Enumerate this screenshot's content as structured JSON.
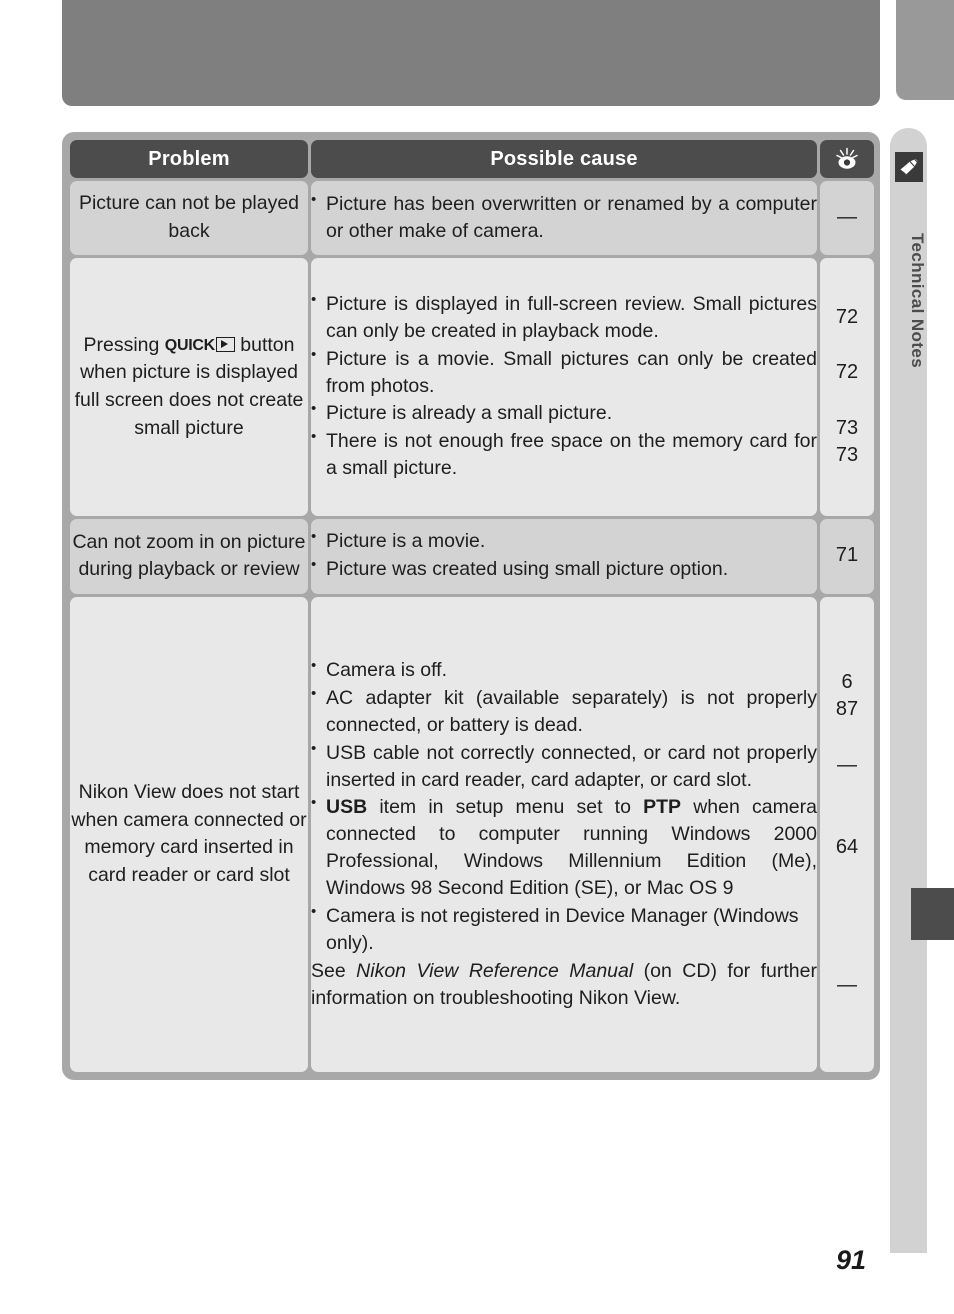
{
  "page": {
    "number": "91",
    "side_tab_label": "Technical Notes",
    "side_tab_icon": "pencil-note-icon"
  },
  "table": {
    "headers": {
      "problem": "Problem",
      "cause": "Possible cause",
      "page": "lightbulb-icon"
    },
    "rows": [
      {
        "problem": "Picture can not be played back",
        "causes": [
          "Picture has been overwritten or renamed by a computer or other make of camera."
        ],
        "pages": [
          "—"
        ]
      },
      {
        "problem_prefix": "Pressing ",
        "problem_badge": "QUICK",
        "problem_suffix": " button when picture is displayed full screen does not create small picture",
        "problem": "Pressing QUICK▶ button when picture is displayed full screen does not create small picture",
        "causes": [
          "Picture is displayed in full-screen review.  Small pictures can only be created in playback mode.",
          "Picture is a movie.  Small pictures can only be created from photos.",
          "Picture is already a small picture.",
          "There is not enough free space on the memory card for a small picture."
        ],
        "pages": [
          "72",
          "72",
          "73",
          "73"
        ]
      },
      {
        "problem": "Can not zoom in on picture during playback or review",
        "causes": [
          "Picture is a movie.",
          "Picture was created using small picture option."
        ],
        "pages": [
          "71"
        ]
      },
      {
        "problem": "Nikon View does not start when camera connected or memory card inserted in card reader or card slot",
        "causes": [
          "Camera is off.",
          "AC adapter kit (available separately) is not properly connected, or battery is dead.",
          "USB cable not correctly connected, or card not properly inserted in card reader, card adapter, or card slot.",
          "USB item in setup menu set to PTP when camera connected to computer running Windows 2000 Professional, Windows Millennium Edition (Me), Windows 98 Second Edition (SE), or Mac OS 9",
          "Camera is not registered in Device Manager (Windows only)."
        ],
        "note": "See Nikon View Reference Manual (on CD) for further information on troubleshooting Nikon View.",
        "note_italic_part": "Nikon View Reference Manual",
        "pages": [
          "6",
          "87",
          "—",
          "64",
          "—"
        ]
      }
    ]
  },
  "colors": {
    "header_bg": "#4c4c4c",
    "frame": "#a8a8a8",
    "row_shade_a": "#d3d3d3",
    "row_shade_b": "#e8e8e8",
    "banner": "#7f7f7f",
    "side_tab": "#d2d2d2",
    "edge_marker": "#4c4c4c",
    "text": "#1e1e1e"
  }
}
